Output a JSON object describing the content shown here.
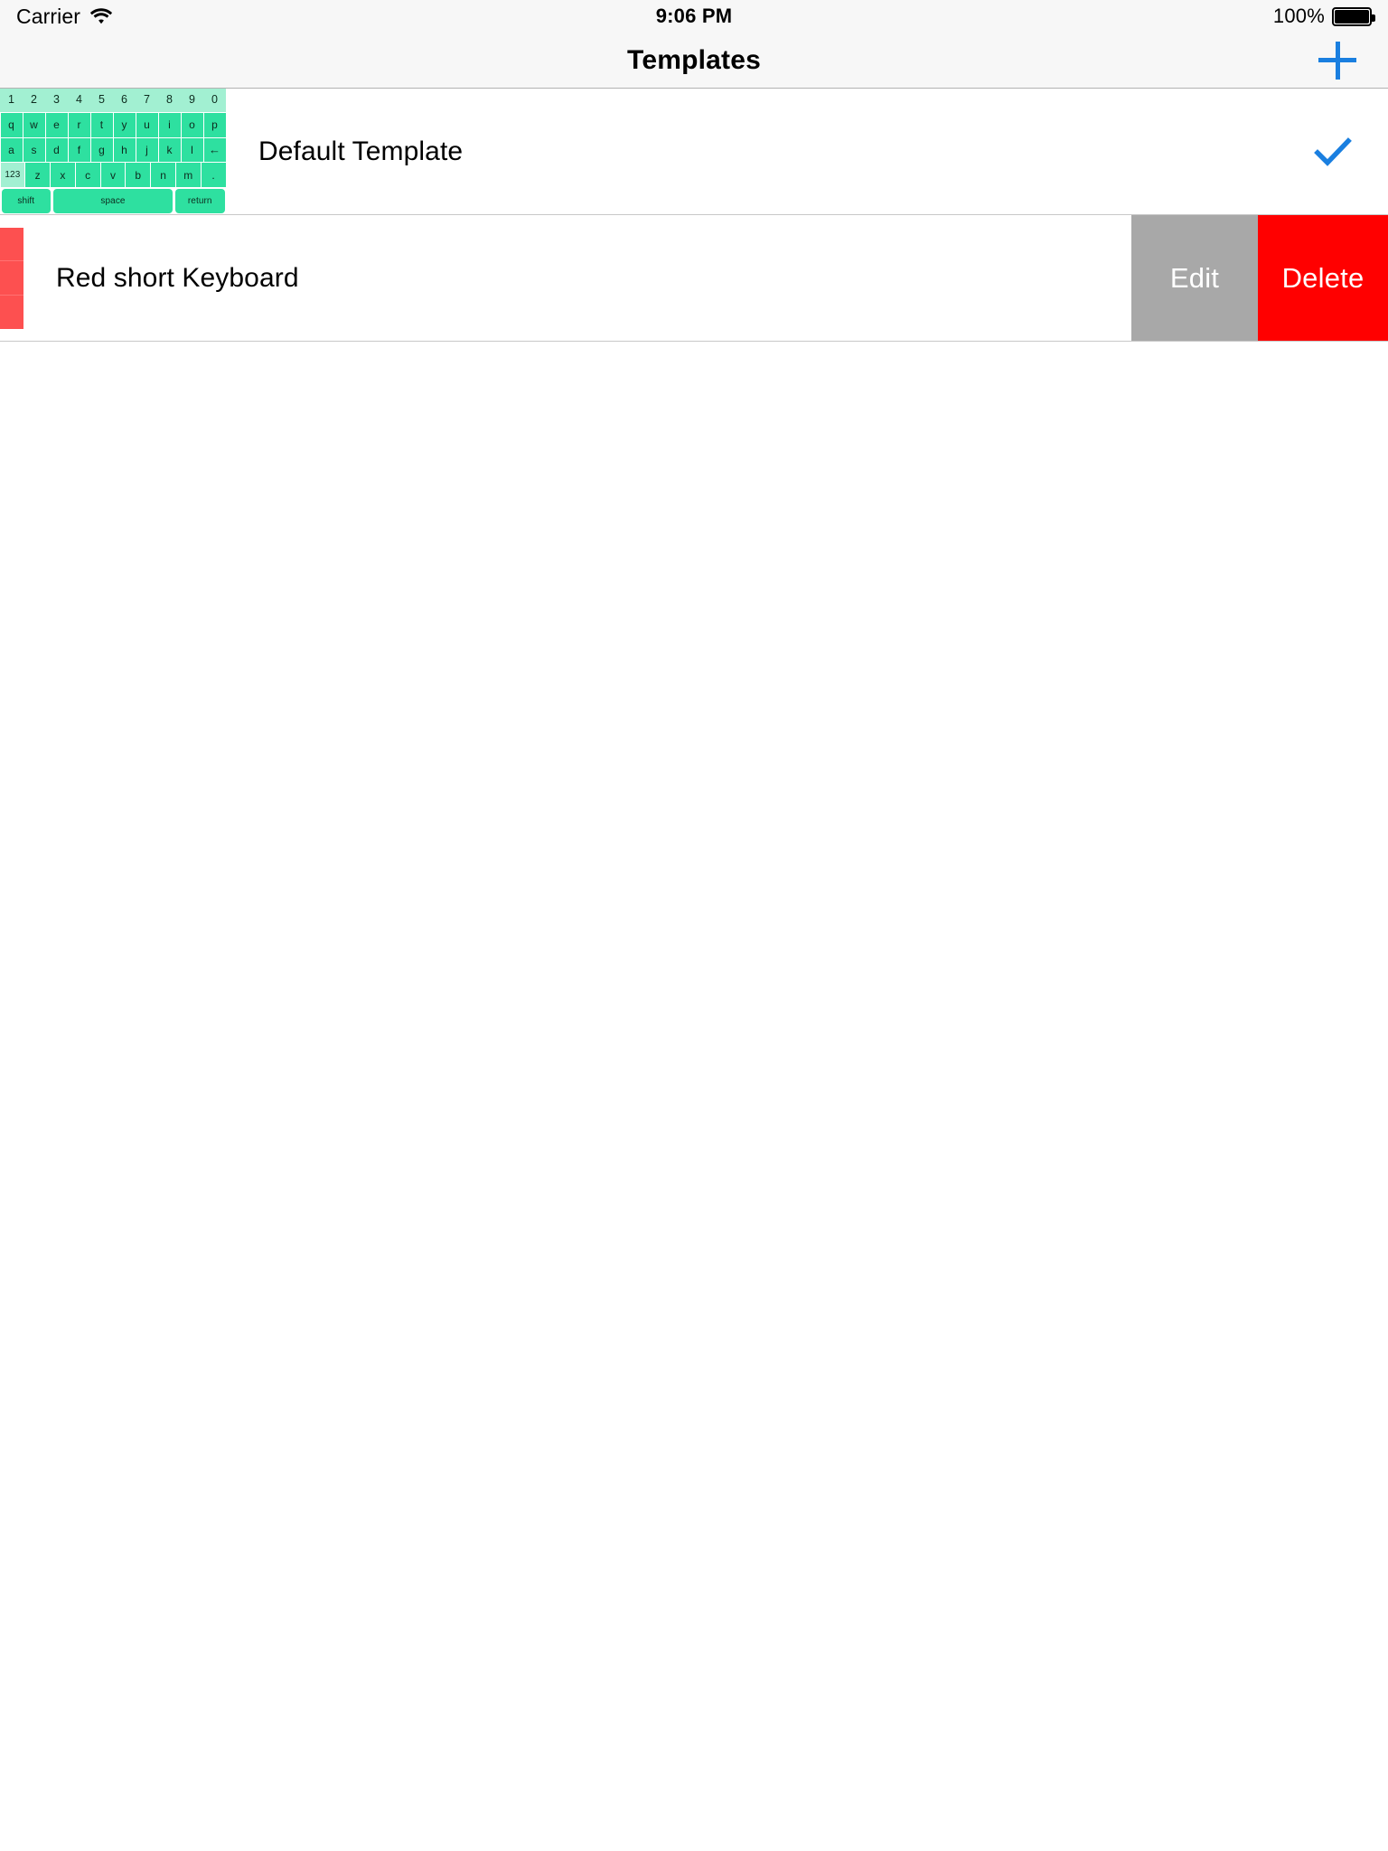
{
  "status_bar": {
    "carrier": "Carrier",
    "wifi_icon": "wifi-icon",
    "time": "9:06 PM",
    "battery_percent": "100%",
    "battery_icon": "battery-full-icon",
    "battery_level": 100
  },
  "nav_bar": {
    "title": "Templates",
    "add_button_icon": "plus-icon",
    "accent_color": "#1a7fe0"
  },
  "templates": [
    {
      "name": "Default Template",
      "selected": true,
      "check_icon": "checkmark-icon",
      "check_color": "#1a7fe0",
      "thumbnail": {
        "style": "green-keyboard",
        "number_row_color": "#a2f0d2",
        "key_color": "#2ee0a0",
        "rows": [
          [
            "1",
            "2",
            "3",
            "4",
            "5",
            "6",
            "7",
            "8",
            "9",
            "0"
          ],
          [
            "q",
            "w",
            "e",
            "r",
            "t",
            "y",
            "u",
            "i",
            "o",
            "p"
          ],
          [
            "a",
            "s",
            "d",
            "f",
            "g",
            "h",
            "j",
            "k",
            "l",
            "←"
          ],
          [
            "123",
            "z",
            "x",
            "c",
            "v",
            "b",
            "n",
            "m",
            "."
          ],
          [
            "shift",
            "space",
            "return"
          ]
        ]
      }
    },
    {
      "name": "Red short Keyboard",
      "selected": false,
      "swiped": true,
      "thumbnail": {
        "style": "red-keyboard",
        "key_color": "#fd5050",
        "row_count": 3
      },
      "actions": [
        {
          "label": "Edit",
          "color": "#a8a8a8"
        },
        {
          "label": "Delete",
          "color": "#ff0000"
        }
      ]
    }
  ]
}
